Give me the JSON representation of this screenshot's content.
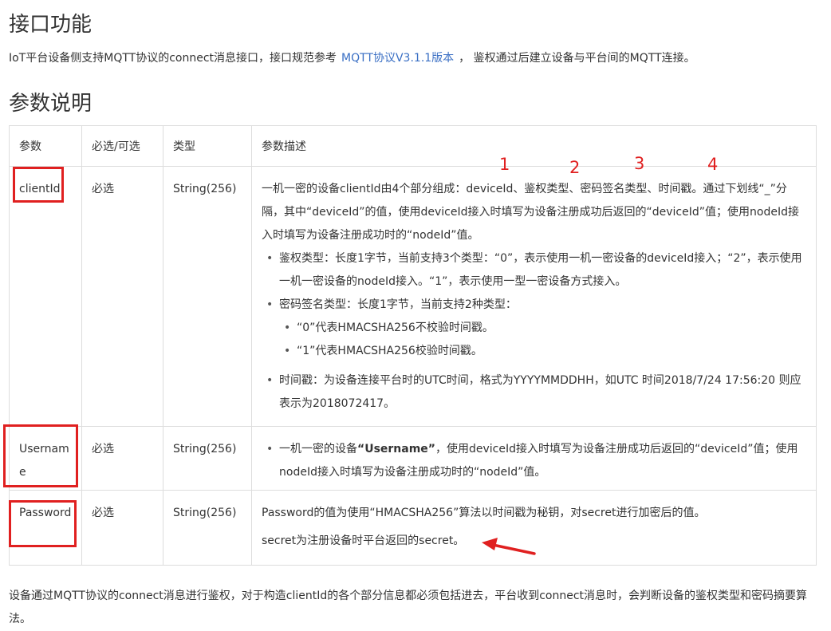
{
  "page": {
    "title": "接口功能",
    "intro": {
      "before": "IoT平台设备侧支持MQTT协议的connect消息接口，接口规范参考",
      "link": "MQTT协议V3.1.1版本",
      "after": "，  鉴权通过后建立设备与平台间的MQTT连接。"
    },
    "section_title": "参数说明"
  },
  "table": {
    "headers": [
      "参数",
      "必选/可选",
      "类型",
      "参数描述"
    ],
    "rows": [
      {
        "param": "clientId",
        "required": "必选",
        "type": "String(256)",
        "desc_intro": "一机一密的设备clientId由4个部分组成：deviceId、鉴权类型、密码签名类型、时间戳。通过下划线“_”分隔，其中“deviceId”的值，使用deviceId接入时填写为设备注册成功后返回的“deviceId”值；使用nodeId接入时填写为设备注册成功时的“nodeId”值。",
        "bullet_auth": "鉴权类型：长度1字节，当前支持3个类型：“0”，表示使用一机一密设备的deviceId接入；“2”，表示使用一机一密设备的nodeId接入。“1”，表示使用一型一密设备方式接入。",
        "bullet_sign": "密码签名类型：长度1字节，当前支持2种类型：",
        "sub_bullet_1": "“0”代表HMACSHA256不校验时间戳。",
        "sub_bullet_2": "“1”代表HMACSHA256校验时间戳。",
        "bullet_time": "时间戳：为设备连接平台时的UTC时间，格式为YYYYMMDDHH，如UTC 时间2018/7/24 17:56:20 则应表示为2018072417。"
      },
      {
        "param": "Username",
        "required": "必选",
        "type": "String(256)",
        "desc_before": "一机一密的设备",
        "desc_bold": "“Username”",
        "desc_after": "，使用deviceId接入时填写为设备注册成功后返回的“deviceId”值；使用nodeId接入时填写为设备注册成功时的“nodeId”值。"
      },
      {
        "param": "Password",
        "required": "必选",
        "type": "String(256)",
        "desc_line1": "Password的值为使用“HMACSHA256”算法以时间戳为秘钥，对secret进行加密后的值。",
        "desc_line2": "secret为注册设备时平台返回的secret。"
      }
    ]
  },
  "annotations": {
    "numbers": [
      "1",
      "2",
      "3",
      "4"
    ],
    "color": "#e02020"
  },
  "outro": "设备通过MQTT协议的connect消息进行鉴权，对于构造clientId的各个部分信息都必须包括进去，平台收到connect消息时，会判断设备的鉴权类型和密码摘要算法。",
  "colors": {
    "link": "#3a6fc4",
    "border": "#dddddd",
    "text": "#333333"
  }
}
